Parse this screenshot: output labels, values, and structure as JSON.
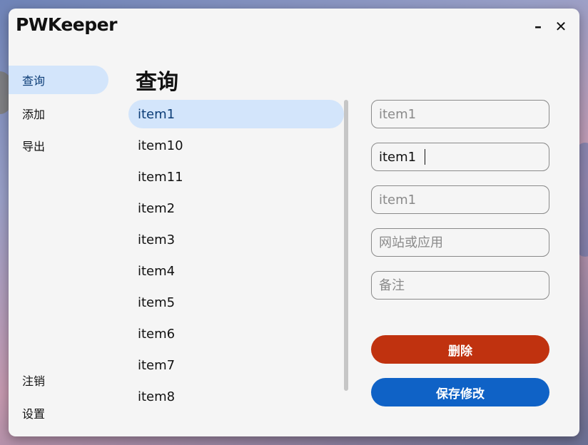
{
  "window": {
    "title": "PWKeeper",
    "minimize_label": "–",
    "close_label": "✕"
  },
  "sidebar": {
    "items": [
      {
        "label": "查询"
      },
      {
        "label": "添加"
      },
      {
        "label": "导出"
      },
      {
        "label": "注销"
      },
      {
        "label": "设置"
      }
    ],
    "active_index": 0
  },
  "main": {
    "title": "查询",
    "list": {
      "items": [
        "item1",
        "item10",
        "item11",
        "item2",
        "item3",
        "item4",
        "item5",
        "item6",
        "item7",
        "item8"
      ],
      "selected_index": 0
    }
  },
  "form": {
    "fields": [
      {
        "value": "",
        "placeholder": "item1"
      },
      {
        "value": "item1",
        "placeholder": ""
      },
      {
        "value": "",
        "placeholder": "item1"
      },
      {
        "value": "",
        "placeholder": "网站或应用"
      },
      {
        "value": "",
        "placeholder": "备注"
      }
    ],
    "delete_label": "删除",
    "save_label": "保存修改"
  },
  "colors": {
    "delete_button": "#c0320f",
    "save_button": "#0f62c6",
    "selected_background": "#d3e5fb",
    "window_background": "#f5f5f5"
  }
}
